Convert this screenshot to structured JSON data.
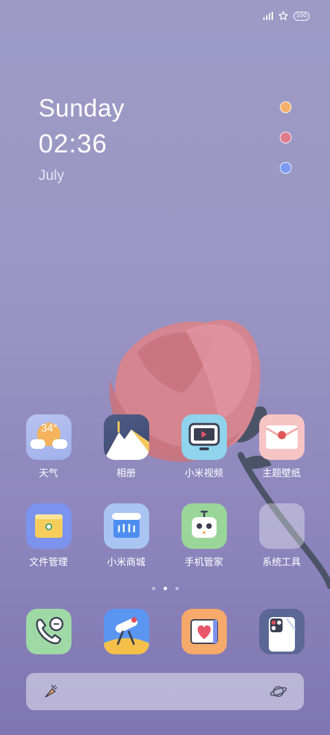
{
  "status_bar": {
    "battery": "100",
    "icons": [
      "signal-icon",
      "star-icon",
      "battery-icon"
    ]
  },
  "clock_widget": {
    "day": "Sunday",
    "time": "02:36",
    "month": "July"
  },
  "color_dots": [
    "#f3b26b",
    "#e07a8c",
    "#7c9cf2"
  ],
  "row1": [
    {
      "label": "天气",
      "icon": "weather-icon",
      "temp": "34°"
    },
    {
      "label": "相册",
      "icon": "gallery-icon"
    },
    {
      "label": "小米视频",
      "icon": "video-icon"
    },
    {
      "label": "主题壁纸",
      "icon": "themes-icon"
    }
  ],
  "row2": [
    {
      "label": "文件管理",
      "icon": "file-manager-icon"
    },
    {
      "label": "小米商城",
      "icon": "mi-store-icon"
    },
    {
      "label": "手机管家",
      "icon": "security-icon"
    },
    {
      "label": "系统工具",
      "icon": "system-tools-folder-icon"
    }
  ],
  "page_indicator": {
    "count": 3,
    "active": 2
  },
  "dock": [
    "phone-icon",
    "browser-icon",
    "health-icon",
    "camera-icon"
  ],
  "search_bar": {
    "left_icon": "carrot-icon",
    "right_icon": "planet-icon"
  }
}
